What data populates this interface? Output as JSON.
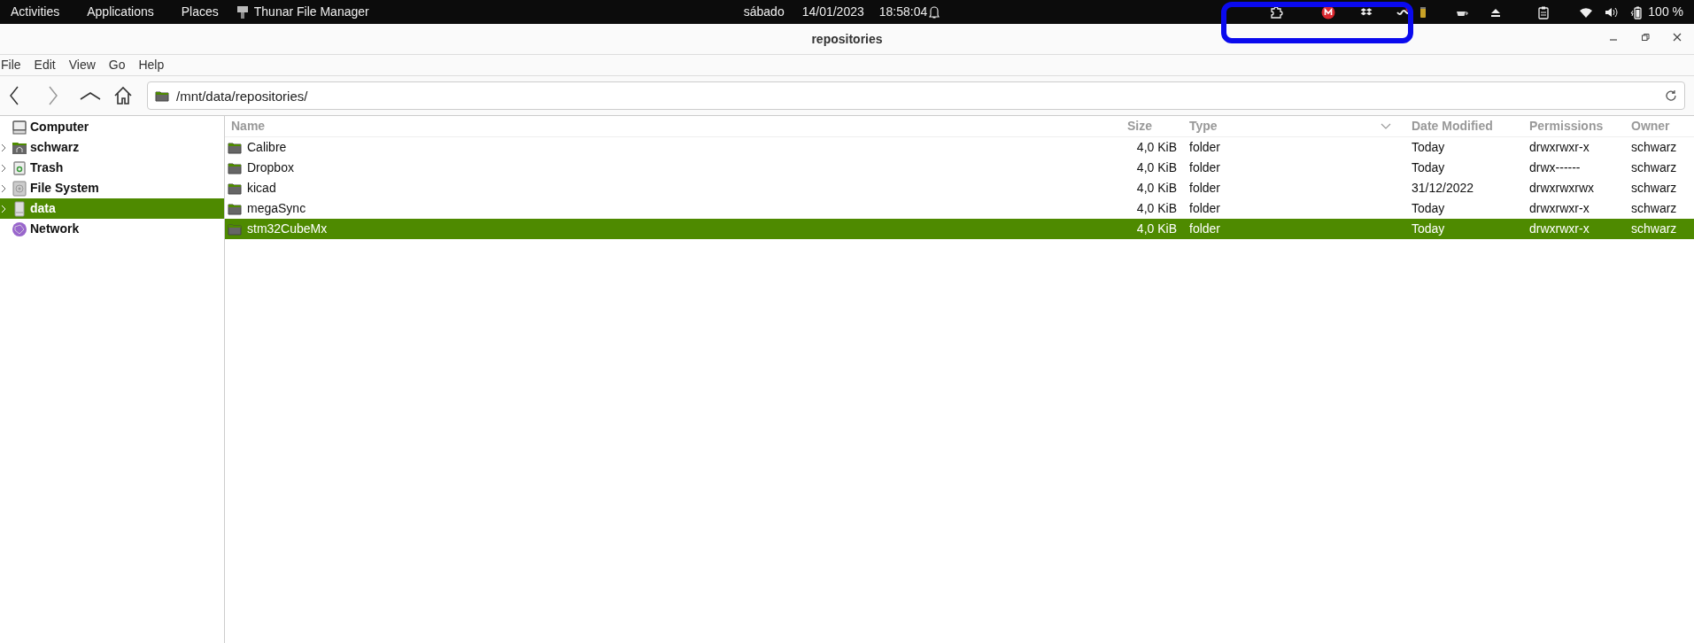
{
  "top_bar": {
    "left": [
      "Activities",
      "Applications",
      "Places"
    ],
    "app": {
      "label": "Thunar File Manager"
    },
    "clock": {
      "day": "sábado",
      "date": "14/01/2023",
      "time": "18:58:04"
    },
    "tray": [
      {
        "kind": "puzzle"
      },
      {
        "kind": "mega"
      },
      {
        "kind": "dropbox"
      },
      {
        "kind": "wave"
      },
      {
        "kind": "jar"
      },
      {
        "kind": "cup"
      },
      {
        "kind": "eject"
      },
      {
        "kind": "clipboard"
      },
      {
        "kind": "wifi"
      },
      {
        "kind": "volume"
      },
      {
        "kind": "battery"
      }
    ],
    "battery_label": "100 %"
  },
  "annotation": {
    "kind": "rounded-rectangle"
  },
  "window": {
    "title": "repositories"
  },
  "menu": [
    "File",
    "Edit",
    "View",
    "Go",
    "Help"
  ],
  "location": {
    "value": "/mnt/data/repositories/"
  },
  "sidebar": {
    "items": [
      {
        "label": "Computer",
        "kind": "computer",
        "expandable": false,
        "selected": false
      },
      {
        "label": "schwarz",
        "kind": "home",
        "expandable": true,
        "selected": false
      },
      {
        "label": "Trash",
        "kind": "trash",
        "expandable": true,
        "selected": false
      },
      {
        "label": "File System",
        "kind": "disk",
        "expandable": true,
        "selected": false
      },
      {
        "label": "data",
        "kind": "drive",
        "expandable": true,
        "selected": true
      },
      {
        "label": "Network",
        "kind": "network",
        "expandable": false,
        "selected": false
      }
    ]
  },
  "table": {
    "columns": [
      "Name",
      "Size",
      "Type",
      "Date Modified",
      "Permissions",
      "Owner"
    ],
    "rows": [
      {
        "cells": [
          "Calibre",
          "4,0 KiB",
          "folder",
          "Today",
          "drwxrwxr-x",
          "schwarz"
        ],
        "selected": false
      },
      {
        "cells": [
          "Dropbox",
          "4,0 KiB",
          "folder",
          "Today",
          "drwx------",
          "schwarz"
        ],
        "selected": false
      },
      {
        "cells": [
          "kicad",
          "4,0 KiB",
          "folder",
          "31/12/2022",
          "drwxrwxrwx",
          "schwarz"
        ],
        "selected": false
      },
      {
        "cells": [
          "megaSync",
          "4,0 KiB",
          "folder",
          "Today",
          "drwxrwxr-x",
          "schwarz"
        ],
        "selected": false
      },
      {
        "cells": [
          "stm32CubeMx",
          "4,0 KiB",
          "folder",
          "Today",
          "drwxrwxr-x",
          "schwarz"
        ],
        "selected": true
      }
    ]
  }
}
